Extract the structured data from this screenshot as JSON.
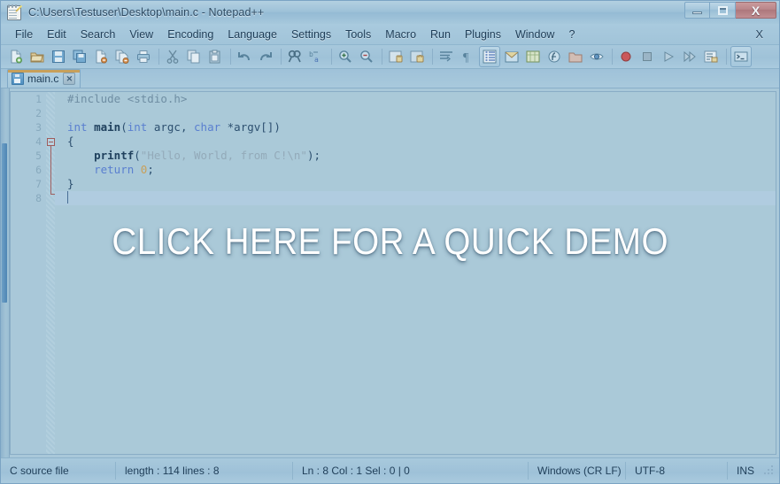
{
  "window": {
    "title": "C:\\Users\\Testuser\\Desktop\\main.c - Notepad++",
    "icon": "notepad-plus-plus-icon",
    "minimize_label": "–",
    "maximize_label": "□",
    "close_label": "X"
  },
  "menubar": {
    "items": [
      {
        "label": "File"
      },
      {
        "label": "Edit"
      },
      {
        "label": "Search"
      },
      {
        "label": "View"
      },
      {
        "label": "Encoding"
      },
      {
        "label": "Language"
      },
      {
        "label": "Settings"
      },
      {
        "label": "Tools"
      },
      {
        "label": "Macro"
      },
      {
        "label": "Run"
      },
      {
        "label": "Plugins"
      },
      {
        "label": "Window"
      },
      {
        "label": "?"
      }
    ],
    "close_document_label": "X"
  },
  "toolbar": {
    "icons": [
      "new-file-icon",
      "open-file-icon",
      "save-icon",
      "save-all-icon",
      "close-file-icon",
      "close-all-icon",
      "print-icon",
      "cut-icon",
      "copy-icon",
      "paste-icon",
      "undo-icon",
      "redo-icon",
      "find-icon",
      "replace-icon",
      "zoom-in-icon",
      "zoom-out-icon",
      "sync-vertical-scroll-icon",
      "sync-horizontal-scroll-icon",
      "word-wrap-icon",
      "show-pilcrow-icon",
      "indent-guide-icon",
      "user-defined-language-icon",
      "document-map-icon",
      "function-list-icon",
      "folder-as-workspace-icon",
      "monitor-icon",
      "record-macro-icon",
      "stop-recording-icon",
      "play-macro-icon",
      "run-macro-multiple-icon",
      "save-macro-icon",
      "run-icon"
    ]
  },
  "tabs": [
    {
      "label": "main.c",
      "icon": "saved-file-icon",
      "close_label": "✕",
      "active": true
    }
  ],
  "editor": {
    "line_numbers": [
      "1",
      "2",
      "3",
      "4",
      "5",
      "6",
      "7",
      "8"
    ],
    "current_line": 8,
    "fold_marker_line": 4,
    "lines": [
      {
        "n": "1",
        "tokens": [
          {
            "t": "#include <stdio.h>",
            "c": "tok-pre"
          }
        ]
      },
      {
        "n": "2",
        "tokens": []
      },
      {
        "n": "3",
        "tokens": [
          {
            "t": "int",
            "c": "tok-kw"
          },
          {
            "t": " ",
            "c": "tok-pun"
          },
          {
            "t": "main",
            "c": "tok-fn"
          },
          {
            "t": "(",
            "c": "tok-pun"
          },
          {
            "t": "int",
            "c": "tok-kw"
          },
          {
            "t": " argc, ",
            "c": "tok-id"
          },
          {
            "t": "char",
            "c": "tok-kw"
          },
          {
            "t": " *argv[])",
            "c": "tok-id"
          }
        ]
      },
      {
        "n": "4",
        "tokens": [
          {
            "t": "{",
            "c": "tok-pun"
          }
        ]
      },
      {
        "n": "5",
        "tokens": [
          {
            "t": "    ",
            "c": "tok-pun"
          },
          {
            "t": "printf",
            "c": "tok-fn"
          },
          {
            "t": "(",
            "c": "tok-pun"
          },
          {
            "t": "\"Hello, World, from C!\\n\"",
            "c": "tok-str"
          },
          {
            "t": ");",
            "c": "tok-pun"
          }
        ]
      },
      {
        "n": "6",
        "tokens": [
          {
            "t": "    ",
            "c": "tok-pun"
          },
          {
            "t": "return",
            "c": "tok-kw"
          },
          {
            "t": " ",
            "c": "tok-pun"
          },
          {
            "t": "0",
            "c": "tok-num"
          },
          {
            "t": ";",
            "c": "tok-pun"
          }
        ]
      },
      {
        "n": "7",
        "tokens": [
          {
            "t": "}",
            "c": "tok-pun"
          }
        ]
      },
      {
        "n": "8",
        "tokens": []
      }
    ]
  },
  "overlay": {
    "text": "CLICK HERE FOR A QUICK DEMO"
  },
  "statusbar": {
    "file_type": "C source file",
    "length_lines": "length : 114    lines : 8",
    "position": "Ln : 8    Col : 1    Sel : 0 | 0",
    "eol": "Windows (CR LF)",
    "encoding": "UTF-8",
    "insert_mode": "INS"
  },
  "colors": {
    "window_bg": "#a9cade",
    "editor_bg": "#aac9d8",
    "accent_tab": "#c8a05a",
    "keyword": "#5a7fd0",
    "string": "#93aab9",
    "number": "#c8a05a",
    "fold_marker": "#9e5b5b"
  }
}
